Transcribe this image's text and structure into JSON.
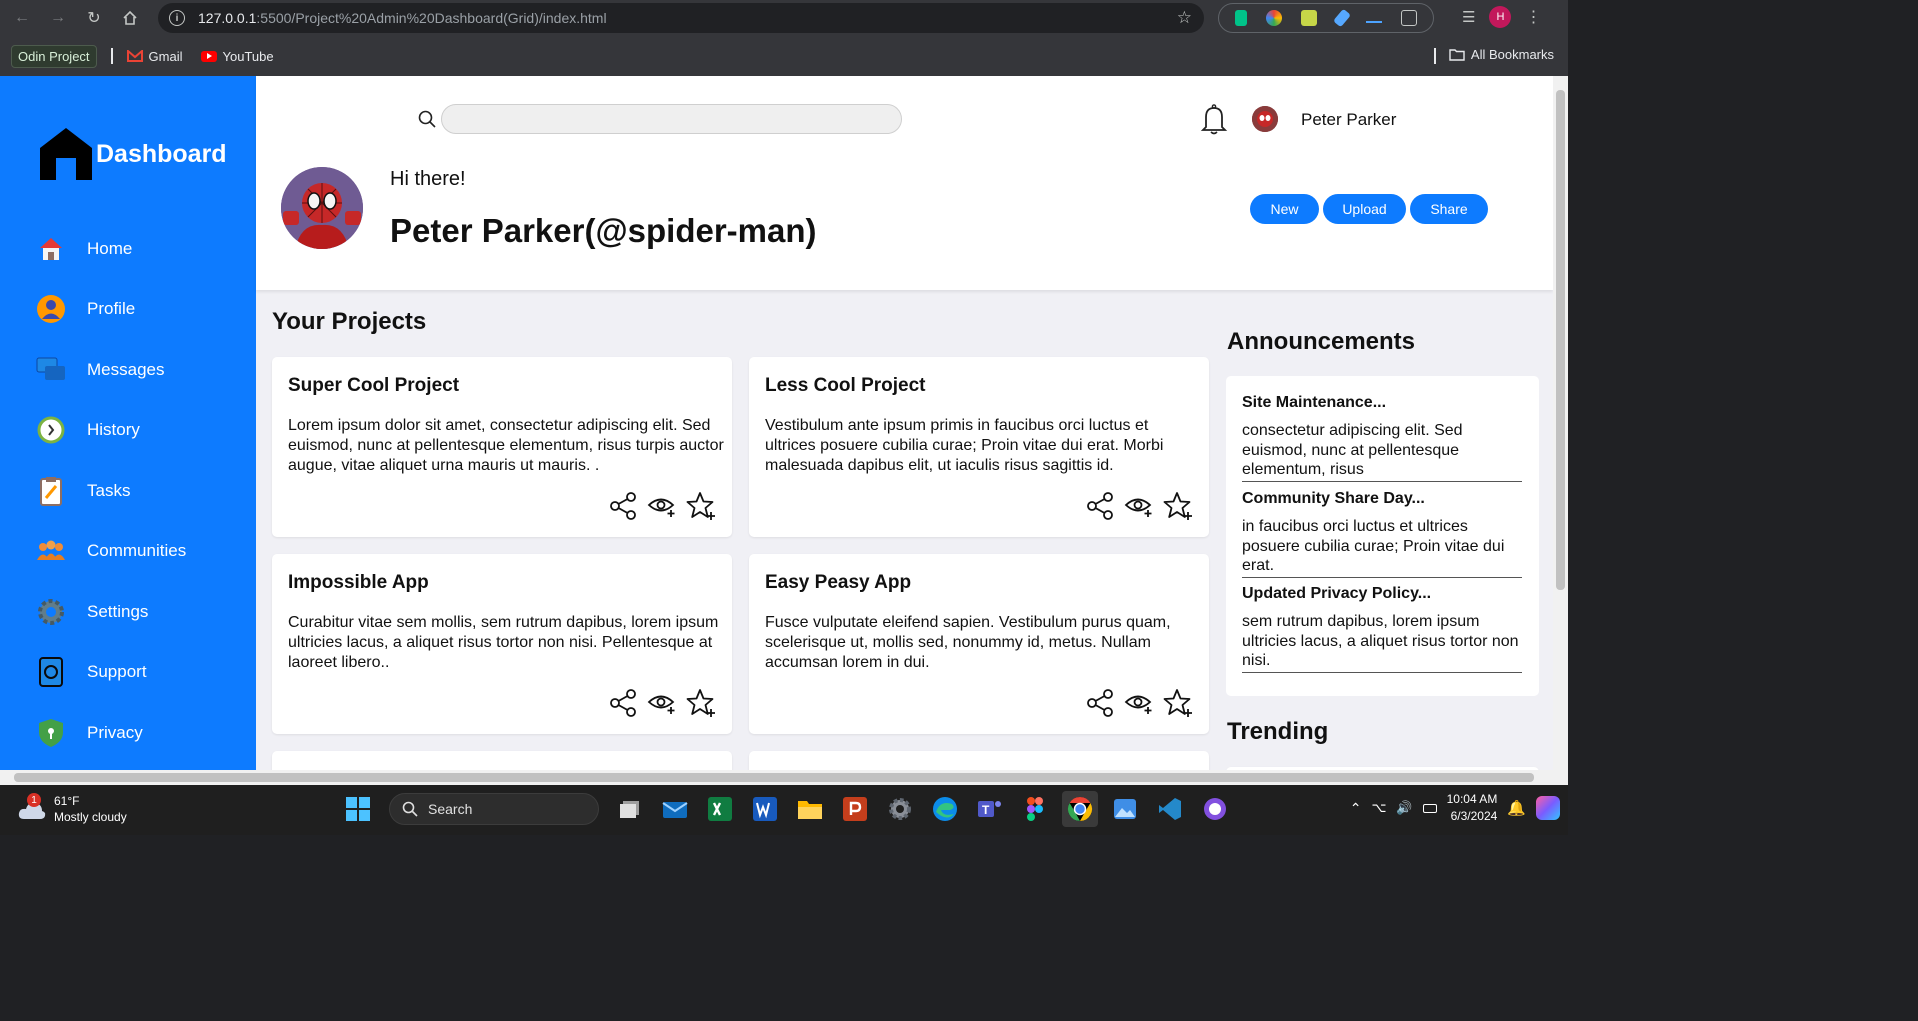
{
  "browser": {
    "url_host": "127.0.0.1",
    "url_rest": ":5500/Project%20Admin%20Dashboard(Grid)/index.html",
    "bookmarks": [
      "Odin Project",
      "Gmail",
      "YouTube"
    ],
    "all_bookmarks": "All Bookmarks",
    "profile_initial": "H"
  },
  "sidebar": {
    "title": "Dashboard",
    "items": [
      {
        "label": "Home",
        "icon": "home-icon"
      },
      {
        "label": "Profile",
        "icon": "profile-icon"
      },
      {
        "label": "Messages",
        "icon": "messages-icon"
      },
      {
        "label": "History",
        "icon": "history-icon"
      },
      {
        "label": "Tasks",
        "icon": "tasks-icon"
      },
      {
        "label": "Communities",
        "icon": "communities-icon"
      },
      {
        "label": "Settings",
        "icon": "settings-icon"
      },
      {
        "label": "Support",
        "icon": "support-icon"
      },
      {
        "label": "Privacy",
        "icon": "privacy-icon"
      }
    ]
  },
  "header": {
    "search_placeholder": "",
    "user_name": "Peter Parker",
    "greeting": "Hi there!",
    "handle": "Peter Parker(@spider-man)",
    "buttons": [
      "New",
      "Upload",
      "Share"
    ]
  },
  "projects": {
    "title": "Your Projects",
    "cards": [
      {
        "title": "Super Cool Project",
        "body": "Lorem ipsum dolor sit amet, consectetur adipiscing elit. Sed euismod, nunc at pellentesque elementum, risus turpis auctor augue, vitae aliquet urna mauris ut mauris. ."
      },
      {
        "title": "Less Cool Project",
        "body": "Vestibulum ante ipsum primis in faucibus orci luctus et ultrices posuere cubilia curae; Proin vitae dui erat. Morbi malesuada dapibus elit, ut iaculis risus sagittis id."
      },
      {
        "title": "Impossible App",
        "body": "Curabitur vitae sem mollis, sem rutrum dapibus, lorem ipsum ultricies lacus, a aliquet risus tortor non nisi. Pellentesque at laoreet libero.."
      },
      {
        "title": "Easy Peasy App",
        "body": "Fusce vulputate eleifend sapien. Vestibulum purus quam, scelerisque ut, mollis sed, nonummy id, metus. Nullam accumsan lorem in dui."
      }
    ]
  },
  "announcements": {
    "title": "Announcements",
    "items": [
      {
        "title": "Site Maintenance...",
        "body": "consectetur adipiscing elit. Sed euismod, nunc at pellentesque elementum, risus"
      },
      {
        "title": "Community Share Day...",
        "body": "in faucibus orci luctus et ultrices posuere cubilia curae; Proin vitae dui erat."
      },
      {
        "title": "Updated Privacy Policy...",
        "body": "sem rutrum dapibus, lorem ipsum ultricies lacus, a aliquet risus tortor non nisi."
      }
    ]
  },
  "trending": {
    "title": "Trending"
  },
  "taskbar": {
    "weather_temp": "61°F",
    "weather_desc": "Mostly cloudy",
    "weather_badge": "1",
    "search_label": "Search",
    "time": "10:04 AM",
    "date": "6/3/2024"
  },
  "colors": {
    "accent": "#0d7bff",
    "page_bg": "#f0f0f5"
  }
}
